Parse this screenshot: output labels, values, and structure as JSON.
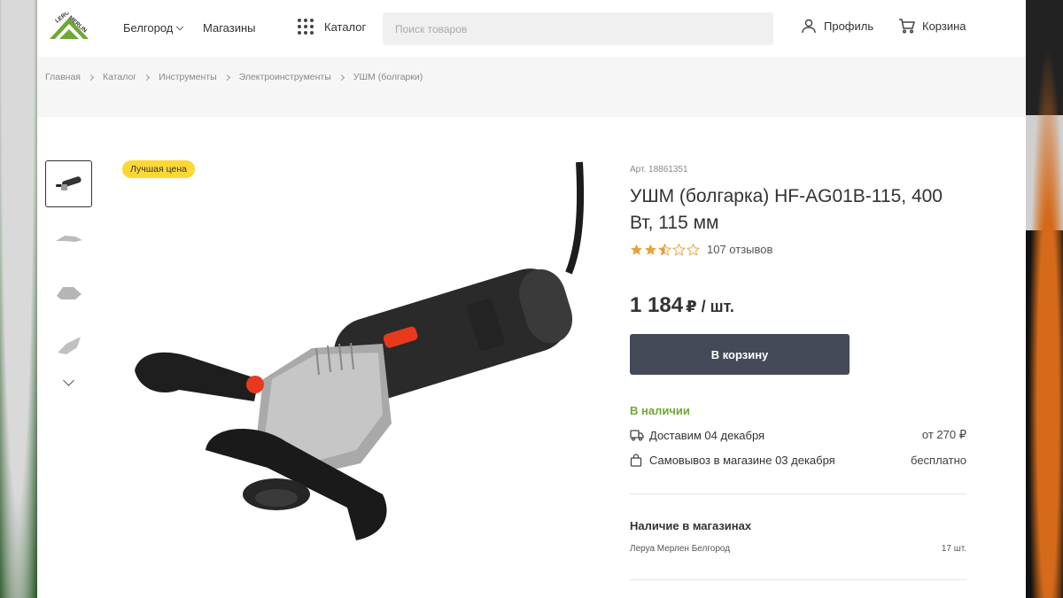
{
  "header": {
    "logo_text": "LEROY MERLIN",
    "city": "Белгород",
    "stores": "Магазины",
    "catalog": "Каталог",
    "search_placeholder": "Поиск товаров",
    "profile": "Профиль",
    "cart": "Корзина"
  },
  "breadcrumbs": [
    "Главная",
    "Каталог",
    "Инструменты",
    "Электроинструменты",
    "УШМ (болгарки)"
  ],
  "gallery": {
    "badge": "Лучшая цена",
    "thumbnails": [
      "angle-grinder-thumb-1",
      "angle-grinder-thumb-2",
      "angle-grinder-thumb-3",
      "angle-grinder-thumb-4"
    ]
  },
  "product": {
    "article": "Арт. 18861351",
    "title": "УШМ (болгарка) HF-AG01B-115, 400 Вт, 115 мм",
    "rating": 2.5,
    "rating_max": 5,
    "reviews": "107 отзывов",
    "price": "1 184",
    "price_unit": "₽ / шт.",
    "add_to_cart": "В корзину",
    "stock": "В наличии",
    "delivery_label": "Доставим 04 декабря",
    "delivery_price": "от 270 ₽",
    "pickup_label": "Самовывоз в магазине 03 декабря",
    "pickup_price": "бесплатно"
  },
  "availability": {
    "title": "Наличие в магазинах",
    "stores": [
      {
        "name": "Леруа Мерлен Белгород",
        "qty": "17 шт."
      }
    ]
  },
  "colors": {
    "accent_green": "#6fa832",
    "button": "#444a58",
    "badge": "#fdd835",
    "star": "#e8a13a"
  }
}
